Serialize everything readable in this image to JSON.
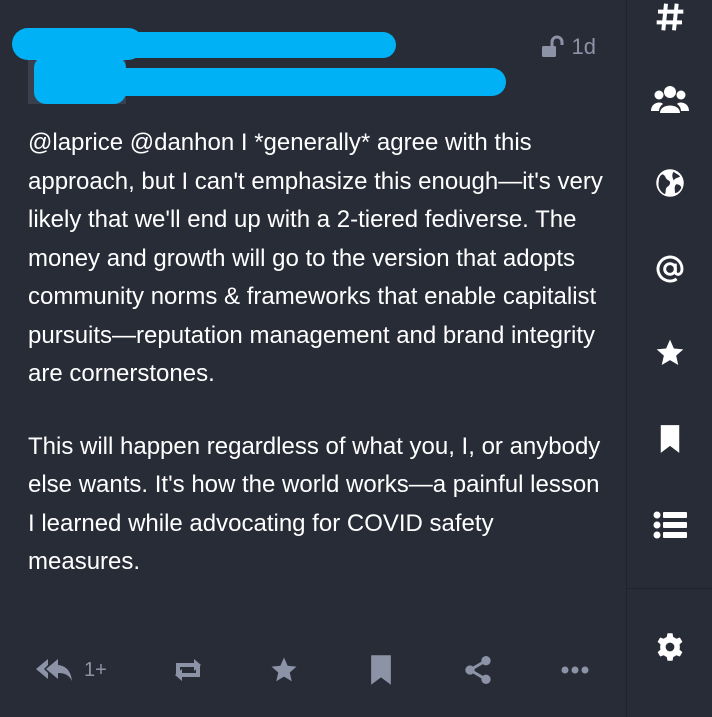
{
  "post": {
    "time": "1d",
    "paragraph_1": {
      "mention_1": "@laprice",
      "mention_2": "@danhon",
      "text": " I *generally* agree with this approach, but I can't emphasize this enough—it's very likely that we'll end up with a 2-tiered fediverse. The money and growth will go to the version that adopts community norms & frameworks that enable capitalist pursuits—reputation management and brand integrity are cornerstones."
    },
    "paragraph_2": "This will happen regardless of what you, I, or anybody else wants. It's how the world works—a painful lesson I learned while advocating for COVID safety measures.",
    "actions": {
      "reply_count": "1+"
    }
  },
  "colors": {
    "background": "#282c37",
    "muted": "#8d93a6",
    "redaction": "#00b2f5"
  },
  "icons": {
    "sidebar": [
      "hashtag-icon",
      "people-icon",
      "globe-icon",
      "at-icon",
      "star-icon",
      "bookmark-icon",
      "list-icon",
      "gear-icon"
    ],
    "actions": [
      "reply-all-icon",
      "boost-icon",
      "star-icon",
      "bookmark-icon",
      "share-icon",
      "more-icon"
    ]
  }
}
